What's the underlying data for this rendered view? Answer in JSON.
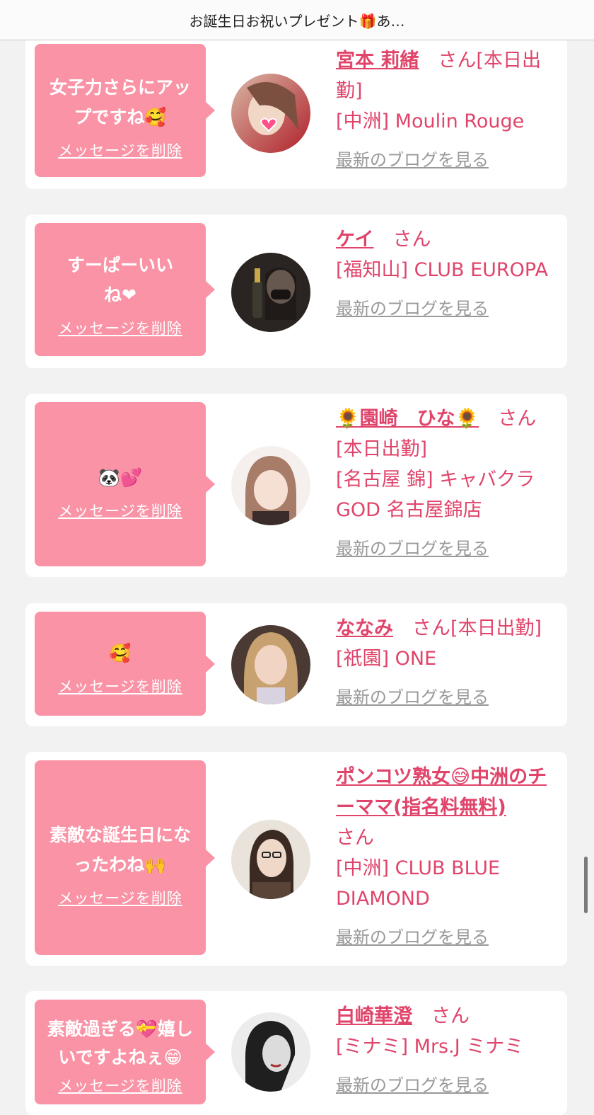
{
  "header": {
    "title": "お誕生日お祝いプレゼント🎁あ…"
  },
  "cards": [
    {
      "message": "女子力さらにアップですね🥰",
      "delete_label": "メッセージを削除",
      "name": "宮本 莉緒",
      "suffix": "さん[本日出勤]",
      "shop": "[中洲] Moulin Rouge",
      "blog_label": "最新のブログを見る"
    },
    {
      "message": "すーぱーいいね❤︎",
      "delete_label": "メッセージを削除",
      "name": "ケイ",
      "suffix": "さん",
      "shop": "[福知山] CLUB EUROPA",
      "blog_label": "最新のブログを見る"
    },
    {
      "message": "🐼💕",
      "delete_label": "メッセージを削除",
      "name": "🌻園崎　ひな🌻",
      "suffix": "さん[本日出勤]",
      "shop": "[名古屋 錦] キャバクラGOD 名古屋錦店",
      "blog_label": "最新のブログを見る"
    },
    {
      "message": "🥰",
      "delete_label": "メッセージを削除",
      "name": "ななみ",
      "suffix": "さん[本日出勤]",
      "shop": "[祇園] ONE",
      "blog_label": "最新のブログを見る"
    },
    {
      "message": "素敵な誕生日になったわね🙌",
      "delete_label": "メッセージを削除",
      "name": "ポンコツ熟女😅中洲のチーママ(指名料無料)",
      "suffix": "さん",
      "shop": "[中洲] CLUB BLUE DIAMOND",
      "blog_label": "最新のブログを見る"
    },
    {
      "message": "素敵過ぎる💝嬉しいですよねぇ😁",
      "delete_label": "メッセージを削除",
      "name": "白崎華澄",
      "suffix": "さん",
      "shop": "[ミナミ] Mrs.J ミナミ",
      "blog_label": "最新のブログを見る"
    }
  ],
  "colors": {
    "accent": "#e0446a",
    "bubble": "#fa93a6",
    "link_gray": "#999999"
  }
}
